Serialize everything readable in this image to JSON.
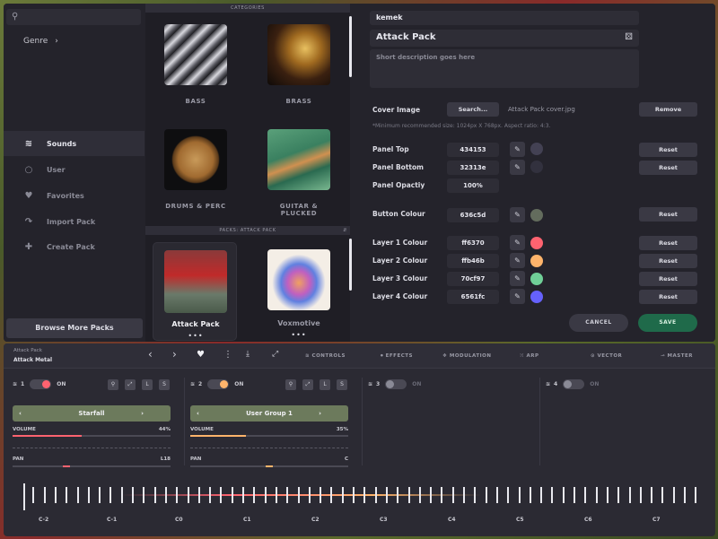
{
  "browser": {
    "sidebar": {
      "genre_label": "Genre",
      "items": [
        {
          "label": "Sounds",
          "icon": "waveform-icon"
        },
        {
          "label": "User",
          "icon": "user-icon"
        },
        {
          "label": "Favorites",
          "icon": "heart-icon"
        },
        {
          "label": "Import Pack",
          "icon": "import-icon"
        },
        {
          "label": "Create Pack",
          "icon": "plus-icon"
        }
      ],
      "browse_label": "Browse More Packs"
    },
    "categories_header": "CATEGORIES",
    "categories": [
      "BASS",
      "BRASS",
      "DRUMS & PERC",
      "GUITAR & PLUCKED"
    ],
    "packs_header": "PACKS: ATTACK PACK",
    "packs": [
      {
        "name": "Attack Pack",
        "more": "•••"
      },
      {
        "name": "Voxmotive",
        "more": "•••"
      }
    ]
  },
  "form": {
    "author": "kemek",
    "pack_name": "Attack Pack",
    "description_placeholder": "Short description goes here",
    "cover_label": "Cover Image",
    "search_btn": "Search...",
    "cover_file": "Attack Pack cover.jpg",
    "remove_btn": "Remove",
    "cover_hint": "*Minimum recommended size: 1024px X 768px. Aspect ratio: 4:3.",
    "rows": [
      {
        "label": "Panel Top",
        "value": "434153",
        "color": "#434153",
        "reset": "Reset"
      },
      {
        "label": "Panel Bottom",
        "value": "32313e",
        "color": "#32313e",
        "reset": "Reset"
      },
      {
        "label": "Panel Opactiy",
        "value": "100%"
      },
      {
        "label": "Button Colour",
        "value": "636c5d",
        "color": "#636c5d",
        "reset": "Reset"
      },
      {
        "label": "Layer 1 Colour",
        "value": "ff6370",
        "color": "#ff6370",
        "reset": "Reset"
      },
      {
        "label": "Layer 2 Colour",
        "value": "ffb46b",
        "color": "#ffb46b",
        "reset": "Reset"
      },
      {
        "label": "Layer 3 Colour",
        "value": "70cf97",
        "color": "#70cf97",
        "reset": "Reset"
      },
      {
        "label": "Layer 4 Colour",
        "value": "6561fc",
        "color": "#6561fc",
        "reset": "Reset"
      }
    ],
    "cancel_btn": "CANCEL",
    "save_btn": "SAVE"
  },
  "synth": {
    "pack": "Attack Pack",
    "preset": "Attack Metal",
    "tabs": [
      "CONTROLS",
      "EFFECTS",
      "MODULATION",
      "ARP",
      "VECTOR",
      "MASTER"
    ],
    "layers": [
      {
        "num": "1",
        "state": "ON",
        "preset": "Starfall",
        "volume_label": "VOLUME",
        "volume": "44%",
        "pan_label": "PAN",
        "pan": "L18",
        "color": "#ff6370",
        "buttons": [
          "L",
          "S"
        ],
        "volume_level": 0.44
      },
      {
        "num": "2",
        "state": "ON",
        "preset": "User Group 1",
        "volume_label": "VOLUME",
        "volume": "35%",
        "pan_label": "PAN",
        "pan": "C",
        "color": "#ffb46b",
        "buttons": [
          "L",
          "S"
        ],
        "volume_level": 0.35
      },
      {
        "num": "3",
        "state": "ON"
      },
      {
        "num": "4",
        "state": "ON"
      }
    ],
    "notes": [
      "C-2",
      "C-1",
      "C0",
      "C1",
      "C2",
      "C3",
      "C4",
      "C5",
      "C6",
      "C7"
    ]
  }
}
